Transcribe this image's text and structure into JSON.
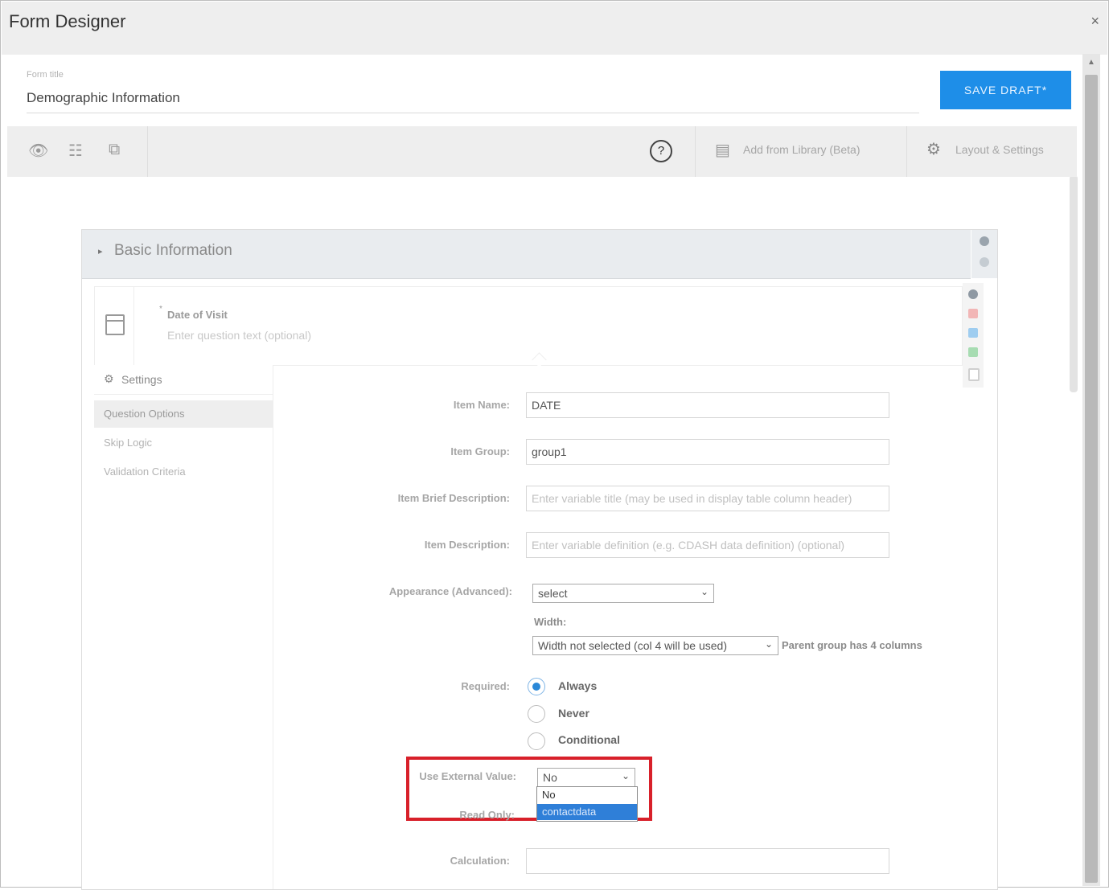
{
  "window": {
    "title": "Form Designer",
    "close_glyph": "×"
  },
  "form_header": {
    "title_label": "Form title",
    "title_value": "Demographic Information",
    "save_button": "SAVE DRAFT*"
  },
  "toolbar": {
    "icons": [
      "eye-icon",
      "list-icon",
      "copy-icon"
    ],
    "help_glyph": "?",
    "add_from_library": "Add from Library (Beta)",
    "layout_settings": "Layout & Settings"
  },
  "section": {
    "title": "Basic Information",
    "caret": "▸"
  },
  "question": {
    "required_mark": "*",
    "label": "Date of Visit",
    "placeholder": "Enter question text (optional)"
  },
  "settings": {
    "header": "Settings",
    "items": [
      {
        "label": "Question Options",
        "active": true
      },
      {
        "label": "Skip Logic",
        "active": false
      },
      {
        "label": "Validation Criteria",
        "active": false
      }
    ]
  },
  "fields": {
    "item_name_label": "Item Name:",
    "item_name_value": "DATE",
    "item_group_label": "Item Group:",
    "item_group_value": "group1",
    "brief_desc_label": "Item Brief Description:",
    "brief_desc_placeholder": "Enter variable title (may be used in display table column header)",
    "desc_label": "Item Description:",
    "desc_placeholder": "Enter variable definition (e.g. CDASH data definition) (optional)",
    "appearance_label": "Appearance (Advanced):",
    "appearance_value": "select",
    "width_label": "Width:",
    "width_value": "Width not selected (col 4 will be used)",
    "width_note": "Parent group has 4 columns",
    "required_label": "Required:",
    "required_options": [
      "Always",
      "Never",
      "Conditional"
    ],
    "required_selected": "Always",
    "external_label": "Use External Value:",
    "external_value": "No",
    "external_options": [
      "No",
      "contactdata"
    ],
    "external_highlighted": "contactdata",
    "readonly_label": "Read Only:",
    "calculation_label": "Calculation:",
    "calculation_value": ""
  },
  "colors": {
    "accent": "#1e8ee8",
    "highlight_box": "#d8202a",
    "dropdown_selected": "#2f7fd8"
  }
}
